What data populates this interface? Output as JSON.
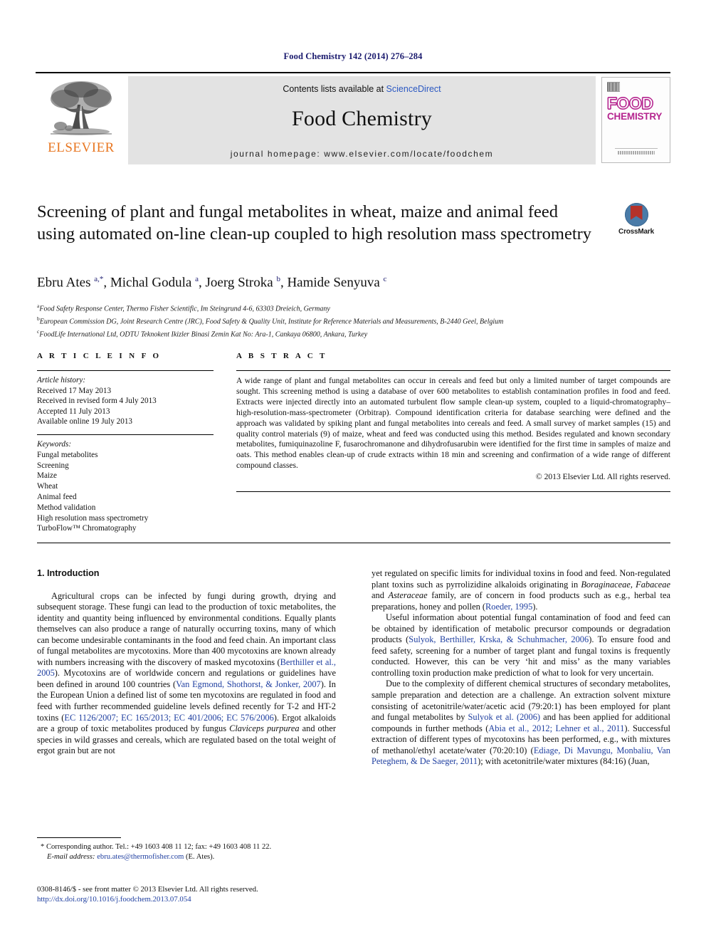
{
  "running_head": "Food Chemistry 142 (2014) 276–284",
  "masthead": {
    "publisher_name": "ELSEVIER",
    "contents_prefix": "Contents lists available at ",
    "contents_link": "ScienceDirect",
    "journal_title": "Food Chemistry",
    "homepage": "journal homepage: www.elsevier.com/locate/foodchem",
    "cover": {
      "word_top": "FOOD",
      "word_bottom": "CHEMISTRY"
    }
  },
  "article": {
    "title": "Screening of plant and fungal metabolites in wheat, maize and animal feed using automated on-line clean-up coupled to high resolution mass spectrometry",
    "crossmark_label": "CrossMark",
    "authors_html": "Ebru Ates <sup>a,*</sup>, Michal Godula <sup>a</sup>, Joerg Stroka <sup>b</sup>, Hamide Senyuva <sup>c</sup>",
    "affiliations": [
      {
        "marker": "a",
        "text": "Food Safety Response Center, Thermo Fisher Scientific, Im Steingrund 4-6, 63303 Dreieich, Germany"
      },
      {
        "marker": "b",
        "text": "European Commission DG, Joint Research Centre (JRC), Food Safety & Quality Unit, Institute for Reference Materials and Measurements, B-2440 Geel, Belgium"
      },
      {
        "marker": "c",
        "text": "FoodLife International Ltd, ODTU Teknokent Ikizler Binasi Zemin Kat No: Ara-1, Cankaya 06800, Ankara, Turkey"
      }
    ]
  },
  "article_info": {
    "heading": "A R T I C L E  I N F O",
    "history_label": "Article history:",
    "history": [
      "Received 17 May 2013",
      "Received in revised form 4 July 2013",
      "Accepted 11 July 2013",
      "Available online 19 July 2013"
    ],
    "keywords_label": "Keywords:",
    "keywords": [
      "Fungal metabolites",
      "Screening",
      "Maize",
      "Wheat",
      "Animal feed",
      "Method validation",
      "High resolution mass spectrometry",
      "TurboFlow™ Chromatography"
    ]
  },
  "abstract": {
    "heading": "A B S T R A C T",
    "body": "A wide range of plant and fungal metabolites can occur in cereals and feed but only a limited number of target compounds are sought. This screening method is using a database of over 600 metabolites to establish contamination profiles in food and feed. Extracts were injected directly into an automated turbulent flow sample clean-up system, coupled to a liquid-chromatography–high-resolution-mass-spectrometer (Orbitrap). Compound identification criteria for database searching were defined and the approach was validated by spiking plant and fungal metabolites into cereals and feed. A small survey of market samples (15) and quality control materials (9) of maize, wheat and feed was conducted using this method. Besides regulated and known secondary metabolites, fumiquinazoline F, fusarochromanone and dihydrofusarubin were identified for the first time in samples of maize and oats. This method enables clean-up of crude extracts within 18 min and screening and confirmation of a wide range of different compound classes.",
    "copyright": "© 2013 Elsevier Ltd. All rights reserved."
  },
  "introduction": {
    "section_title": "1. Introduction",
    "left_paragraph_1": "Agricultural crops can be infected by fungi during growth, drying and subsequent storage. These fungi can lead to the production of toxic metabolites, the identity and quantity being influenced by environmental conditions. Equally plants themselves can also produce a range of naturally occurring toxins, many of which can become undesirable contaminants in the food and feed chain. An important class of fungal metabolites are mycotoxins. More than 400 mycotoxins are known already with numbers increasing with the discovery of masked mycotoxins (",
    "ref_berthiller": "Berthiller et al., 2005",
    "left_frag_2": "). Mycotoxins are of worldwide concern and regulations or guidelines have been defined in around 100 countries (",
    "ref_vanegmond": "Van Egmond, Shothorst, & Jonker, 2007",
    "left_frag_3": "). In the European Union a defined list of some ten mycotoxins are regulated in food and feed with further recommended guideline levels defined recently for T-2 and HT-2 toxins (",
    "ref_ec": "EC 1126/2007; EC 165/2013; EC 401/2006; EC 576/2006",
    "left_frag_4": "). Ergot alkaloids are a group of toxic metabolites produced by fungus ",
    "ital_claviceps": "Claviceps purpurea",
    "left_frag_5": " and other species in wild grasses and cereals, which are regulated based on the total weight of ergot grain but are not",
    "right_frag_1": "yet regulated on specific limits for individual toxins in food and feed. Non-regulated plant toxins such as pyrrolizidine alkaloids originating in ",
    "ital_families": "Boraginaceae, Fabaceae",
    "right_frag_2": " and ",
    "ital_aster": "Asteraceae",
    "right_frag_3": " family, are of concern in food products such as e.g., herbal tea preparations, honey and pollen (",
    "ref_roeder": "Roeder, 1995",
    "right_frag_4": ").",
    "right_paragraph_2a": "Useful information about potential fungal contamination of food and feed can be obtained by identification of metabolic precursor compounds or degradation products (",
    "ref_sulyok1": "Sulyok, Berthiller, Krska, & Schuhmacher, 2006",
    "right_frag_5": "). To ensure food and feed safety, screening for a number of target plant and fungal toxins is frequently conducted. However, this can be very ‘hit and miss’ as the many variables controlling toxin production make prediction of what to look for very uncertain.",
    "right_paragraph_3a": "Due to the complexity of different chemical structures of secondary metabolites, sample preparation and detection are a challenge. An extraction solvent mixture consisting of acetonitrile/water/acetic acid (79:20:1) has been employed for plant and fungal metabolites by ",
    "ref_sulyok2": "Sulyok et al. (2006)",
    "right_frag_6": " and has been applied for additional compounds in further methods (",
    "ref_abia": "Abia et al., 2012; Lehner et al., 2011",
    "right_frag_7": "). Successful extraction of different types of mycotoxins has been performed, e.g., with mixtures of methanol/ethyl acetate/water (70:20:10) (",
    "ref_ediage": "Ediage, Di Mavungu, Monbaliu, Van Peteghem, & De Saeger, 2011",
    "right_frag_8": "); with acetonitrile/water mixtures (84:16) (Juan,"
  },
  "footnote": {
    "star": "*",
    "corresponding": " Corresponding author. Tel.: +49 1603 408 11 12; fax: +49 1603 408 11 22.",
    "email_label": "E-mail address:",
    "email": "ebru.ates@thermofisher.com",
    "email_suffix": " (E. Ates)."
  },
  "imprint": {
    "issn_line": "0308-8146/$ - see front matter © 2013 Elsevier Ltd. All rights reserved.",
    "doi": "http://dx.doi.org/10.1016/j.foodchem.2013.07.054"
  }
}
